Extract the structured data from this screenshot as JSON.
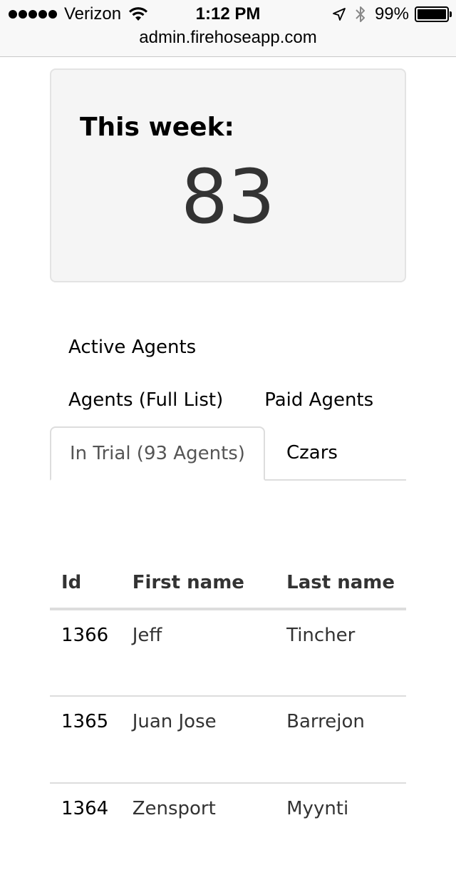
{
  "status_bar": {
    "carrier": "Verizon",
    "time": "1:12 PM",
    "battery": "99%",
    "icons": [
      "signal-dots",
      "wifi-icon",
      "location-icon",
      "bluetooth-icon",
      "battery-icon"
    ]
  },
  "browser": {
    "url": "admin.firehoseapp.com"
  },
  "week_card": {
    "label": "This week:",
    "count": "83"
  },
  "nav": {
    "active_agents": "Active Agents",
    "agents_full_list": "Agents (Full List)",
    "paid_agents": "Paid Agents",
    "in_trial": "In Trial (93 Agents)",
    "czars": "Czars"
  },
  "table": {
    "headers": {
      "id": "Id",
      "first_name": "First name",
      "last_name": "Last name"
    },
    "rows": [
      {
        "id": "1366",
        "first_name": "Jeff",
        "last_name": "Tincher"
      },
      {
        "id": "1365",
        "first_name": "Juan Jose",
        "last_name": "Barrejon"
      },
      {
        "id": "1364",
        "first_name": "Zensport",
        "last_name": "Myynti"
      }
    ]
  }
}
